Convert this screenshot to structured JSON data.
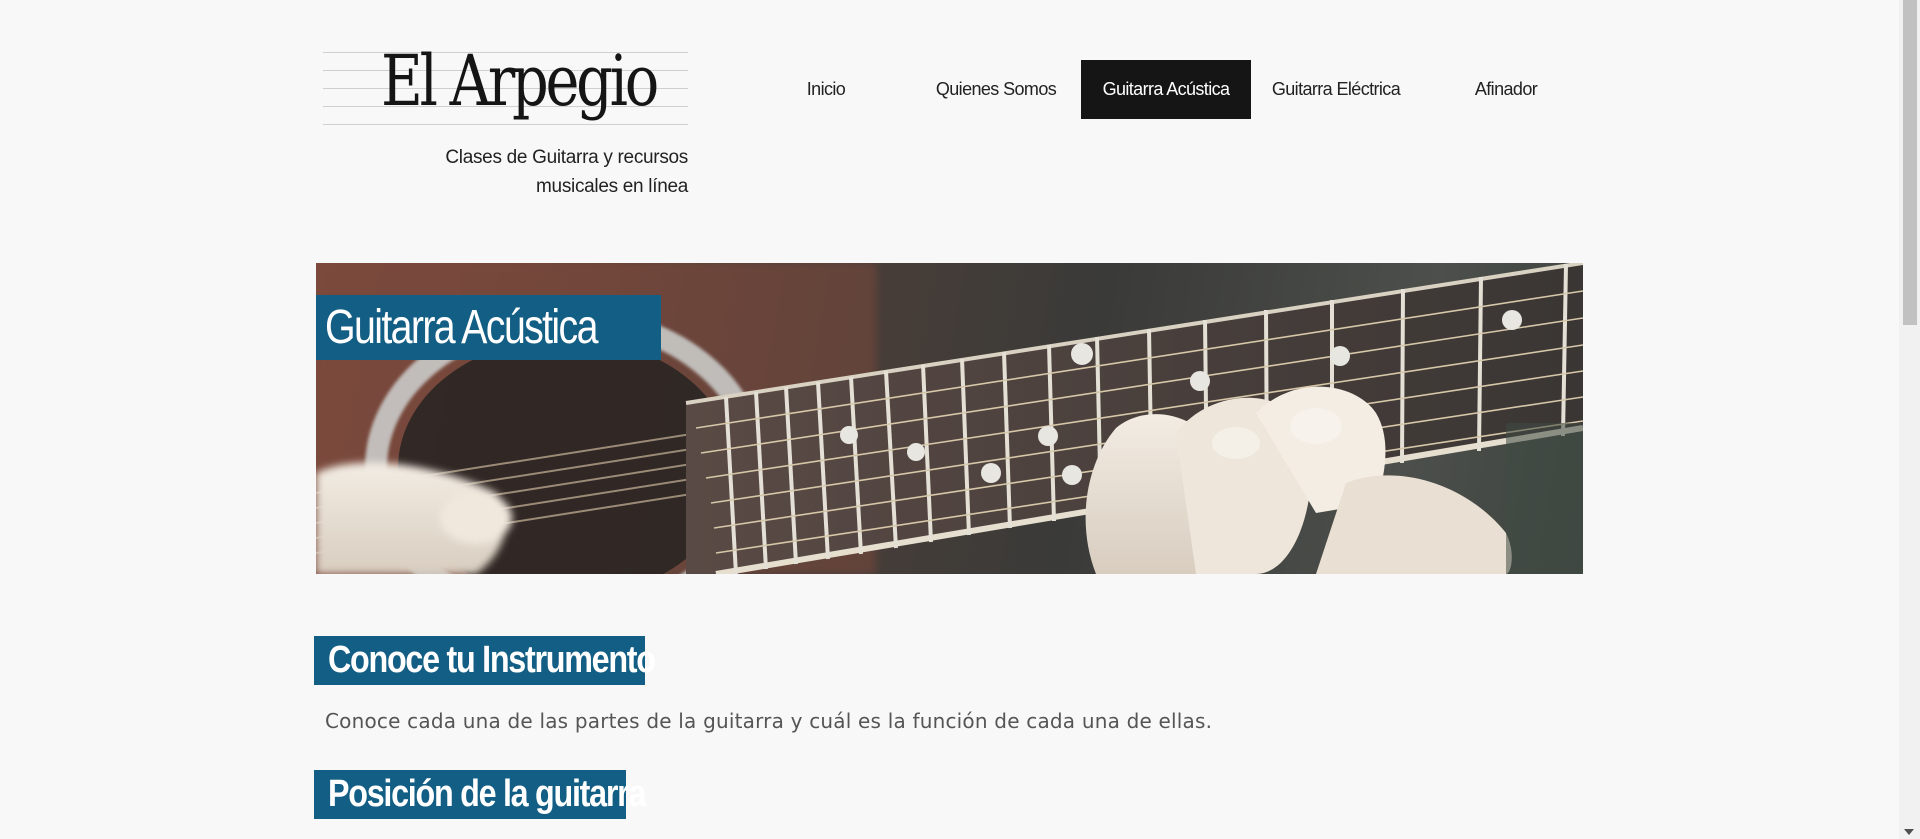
{
  "site": {
    "logo_text": "El Arpegio",
    "tagline_line1": "Clases de Guitarra y recursos",
    "tagline_line2": "musicales en línea"
  },
  "nav": {
    "items": [
      {
        "label": "Inicio",
        "active": false
      },
      {
        "label": "Quienes Somos",
        "active": false
      },
      {
        "label": "Guitarra Acústica",
        "active": true
      },
      {
        "label": "Guitarra Eléctrica",
        "active": false
      },
      {
        "label": "Afinador",
        "active": false
      }
    ]
  },
  "hero": {
    "title": "Guitarra Acústica",
    "image_subject": "acoustic-guitar-fretboard-photo"
  },
  "sections": [
    {
      "heading": "Conoce tu Instrumento",
      "text": "Conoce cada una de las partes de la guitarra y cuál es la función de cada una de ellas."
    },
    {
      "heading": "Posición de la guitarra"
    }
  ],
  "colors": {
    "accent": "#135e84",
    "nav_active_bg": "#151515",
    "page_bg": "#f8f8f8"
  }
}
